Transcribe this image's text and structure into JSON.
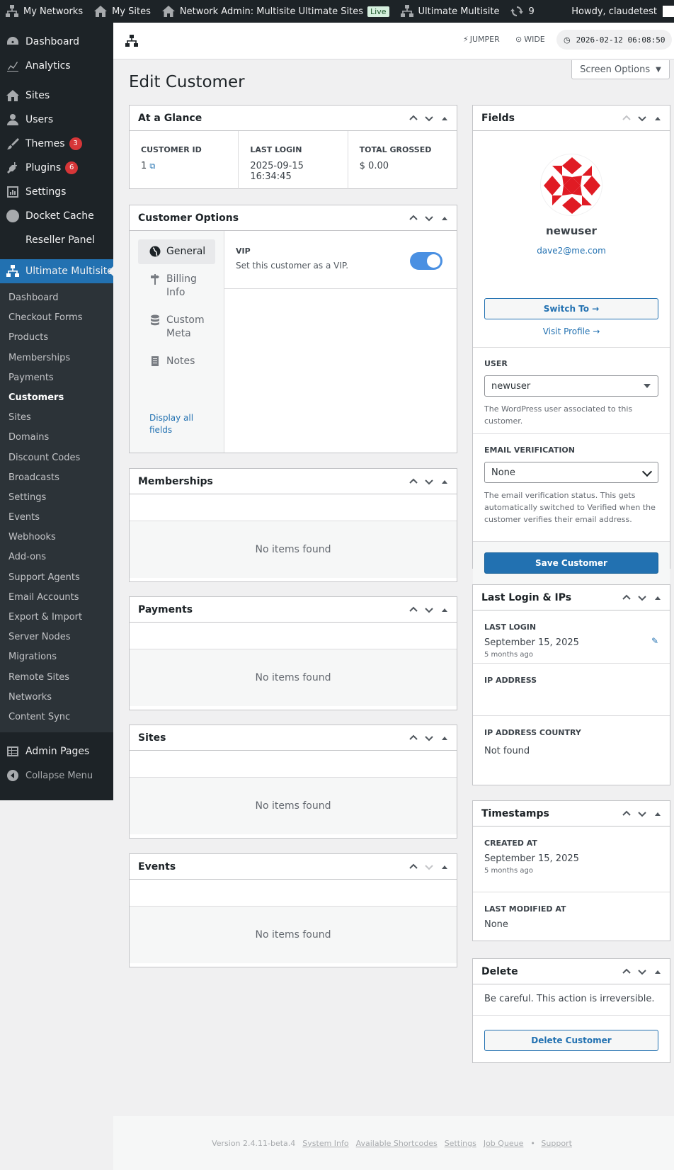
{
  "adminbar": {
    "my_networks": "My Networks",
    "my_sites": "My Sites",
    "network_admin": "Network Admin: Multisite Ultimate Sites",
    "live_badge": "Live",
    "ultimate": "Ultimate Multisite",
    "updates": "9",
    "howdy": "Howdy, claudetest"
  },
  "sidebar": {
    "items": [
      {
        "label": "Dashboard"
      },
      {
        "label": "Analytics"
      },
      {
        "label": "Sites"
      },
      {
        "label": "Users"
      },
      {
        "label": "Themes",
        "count": "3"
      },
      {
        "label": "Plugins",
        "count": "6"
      },
      {
        "label": "Settings"
      },
      {
        "label": "Docket Cache"
      },
      {
        "label": "Reseller Panel"
      }
    ],
    "current": "Ultimate Multisite",
    "submenu": [
      "Dashboard",
      "Checkout Forms",
      "Products",
      "Memberships",
      "Payments",
      "Customers",
      "Sites",
      "Domains",
      "Discount Codes",
      "Broadcasts",
      "Settings",
      "Events",
      "Webhooks",
      "Add-ons",
      "Support Agents",
      "Email Accounts",
      "Export & Import",
      "Server Nodes",
      "Migrations",
      "Remote Sites",
      "Networks",
      "Content Sync"
    ],
    "admin_pages": "Admin Pages",
    "collapse": "Collapse Menu"
  },
  "topbar": {
    "jumper": "JUMPER",
    "wide": "WIDE",
    "clock": "2026-02-12 06:08:50"
  },
  "screen_options": "Screen Options",
  "page_title": "Edit Customer",
  "glance": {
    "title": "At a Glance",
    "customer_id_label": "CUSTOMER ID",
    "customer_id": "1",
    "last_login_label": "LAST LOGIN",
    "last_login": "2025-09-15 16:34:45",
    "total_grossed_label": "TOTAL GROSSED",
    "total_grossed": "$ 0.00"
  },
  "options": {
    "title": "Customer Options",
    "tabs": [
      "General",
      "Billing Info",
      "Custom Meta",
      "Notes"
    ],
    "display_all": "Display all fields",
    "vip_label": "VIP",
    "vip_desc": "Set this customer as a VIP.",
    "vip_on": true
  },
  "memberships": {
    "title": "Memberships",
    "empty": "No items found"
  },
  "payments": {
    "title": "Payments",
    "empty": "No items found"
  },
  "sites": {
    "title": "Sites",
    "empty": "No items found"
  },
  "events": {
    "title": "Events",
    "empty": "No items found"
  },
  "fields": {
    "title": "Fields",
    "name": "newuser",
    "email": "dave2@me.com",
    "switch_to": "Switch To →",
    "visit_profile": "Visit Profile →",
    "user_label": "USER",
    "user_value": "newuser",
    "user_desc": "The WordPress user associated to this customer.",
    "email_verif_label": "EMAIL VERIFICATION",
    "email_verif_value": "None",
    "email_verif_desc": "The email verification status. This gets automatically switched to Verified when the customer verifies their email address.",
    "save": "Save Customer"
  },
  "login": {
    "title": "Last Login & IPs",
    "last_login_label": "LAST LOGIN",
    "last_login": "September 15, 2025",
    "last_login_ago": "5 months ago",
    "ip_label": "IP ADDRESS",
    "ip_country_label": "IP ADDRESS COUNTRY",
    "ip_country": "Not found"
  },
  "timestamps": {
    "title": "Timestamps",
    "created_label": "CREATED AT",
    "created": "September 15, 2025",
    "created_ago": "5 months ago",
    "modified_label": "LAST MODIFIED AT",
    "modified": "None"
  },
  "delete": {
    "title": "Delete",
    "warning": "Be careful. This action is irreversible.",
    "button": "Delete Customer"
  },
  "footer": {
    "version": "Version 2.4.11-beta.4",
    "links": [
      "System Info",
      "Available Shortcodes",
      "Settings",
      "Job Queue"
    ],
    "support": "Support"
  },
  "colors": {
    "accent": "#2271b1",
    "sidebar": "#1d2327",
    "badge": "#d63638",
    "toggle": "#4a90e2"
  }
}
